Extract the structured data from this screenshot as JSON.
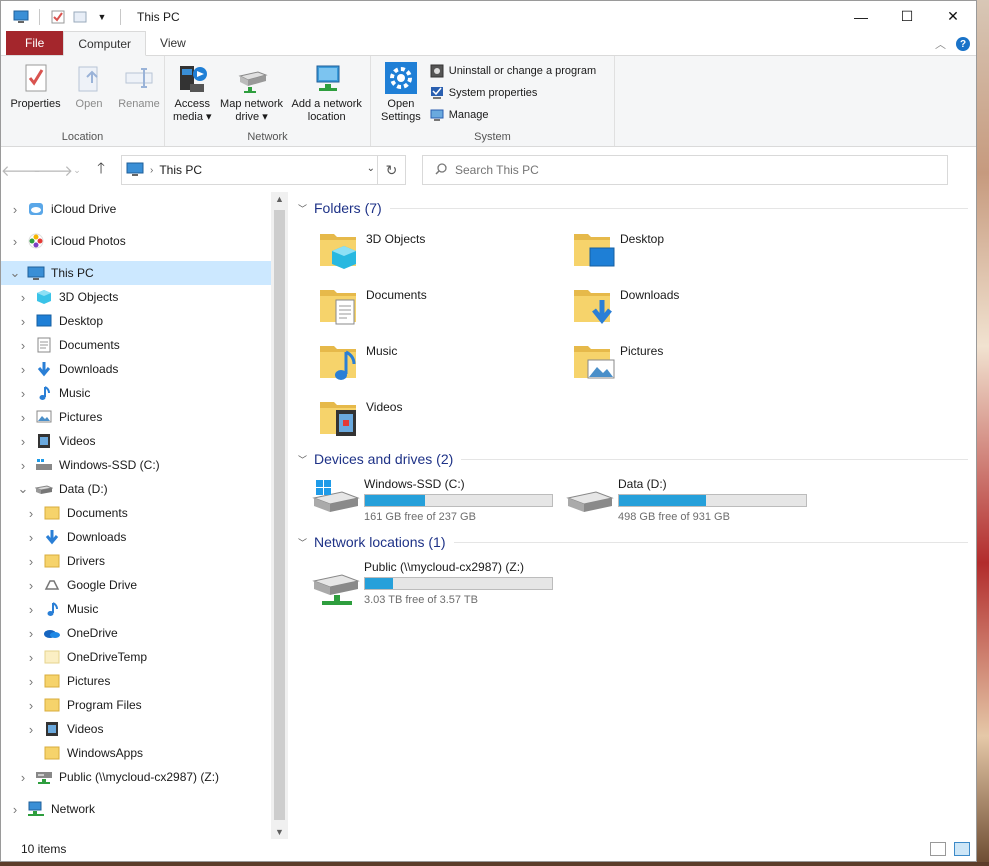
{
  "window": {
    "title": "This PC",
    "controls": {
      "minimize": "—",
      "maximize": "☐",
      "close": "✕"
    }
  },
  "ribbon": {
    "tabs": [
      {
        "label": "File"
      },
      {
        "label": "Computer"
      },
      {
        "label": "View"
      }
    ],
    "groups": {
      "location": {
        "label": "Location",
        "buttons": [
          {
            "label": "Properties",
            "icon": "properties-icon"
          },
          {
            "label": "Open",
            "icon": "open-icon"
          },
          {
            "label": "Rename",
            "icon": "rename-icon"
          }
        ]
      },
      "network": {
        "label": "Network",
        "buttons": [
          {
            "label": "Access\nmedia ▾",
            "line1": "Access",
            "line2": "media ▾",
            "icon": "media-icon"
          },
          {
            "label": "Map network drive ▾",
            "line1": "Map network",
            "line2": "drive ▾",
            "icon": "network-drive-icon"
          },
          {
            "label": "Add a network location",
            "line1": "Add a network",
            "line2": "location",
            "icon": "network-location-icon"
          }
        ]
      },
      "system": {
        "label": "System",
        "open_settings": {
          "line1": "Open",
          "line2": "Settings",
          "icon": "settings-gear-icon"
        },
        "small": [
          {
            "label": "Uninstall or change a program",
            "icon": "uninstall-icon"
          },
          {
            "label": "System properties",
            "icon": "system-properties-icon"
          },
          {
            "label": "Manage",
            "icon": "manage-icon"
          }
        ]
      }
    }
  },
  "address": {
    "path": "This PC",
    "search_placeholder": "Search This PC"
  },
  "nav": {
    "items": [
      {
        "label": "iCloud Drive",
        "level": 0,
        "expand": ">",
        "icon": "icloud-drive-icon"
      },
      {
        "label": "iCloud Photos",
        "level": 0,
        "expand": ">",
        "icon": "icloud-photos-icon"
      },
      {
        "label": "This PC",
        "level": 0,
        "expand": "v",
        "icon": "this-pc-icon",
        "selected": true
      },
      {
        "label": "3D Objects",
        "level": 1,
        "expand": ">",
        "icon": "3d-objects-icon"
      },
      {
        "label": "Desktop",
        "level": 1,
        "expand": ">",
        "icon": "desktop-icon"
      },
      {
        "label": "Documents",
        "level": 1,
        "expand": ">",
        "icon": "documents-icon"
      },
      {
        "label": "Downloads",
        "level": 1,
        "expand": ">",
        "icon": "downloads-icon"
      },
      {
        "label": "Music",
        "level": 1,
        "expand": ">",
        "icon": "music-icon"
      },
      {
        "label": "Pictures",
        "level": 1,
        "expand": ">",
        "icon": "pictures-icon"
      },
      {
        "label": "Videos",
        "level": 1,
        "expand": ">",
        "icon": "videos-icon"
      },
      {
        "label": "Windows-SSD (C:)",
        "level": 1,
        "expand": ">",
        "icon": "windows-drive-icon"
      },
      {
        "label": "Data (D:)",
        "level": 1,
        "expand": "v",
        "icon": "drive-icon"
      },
      {
        "label": "Documents",
        "level": 2,
        "expand": ">",
        "icon": "folder-icon"
      },
      {
        "label": "Downloads",
        "level": 2,
        "expand": ">",
        "icon": "downloads-icon"
      },
      {
        "label": "Drivers",
        "level": 2,
        "expand": ">",
        "icon": "folder-icon"
      },
      {
        "label": "Google Drive",
        "level": 2,
        "expand": ">",
        "icon": "google-drive-icon"
      },
      {
        "label": "Music",
        "level": 2,
        "expand": ">",
        "icon": "music-icon"
      },
      {
        "label": "OneDrive",
        "level": 2,
        "expand": ">",
        "icon": "onedrive-icon"
      },
      {
        "label": "OneDriveTemp",
        "level": 2,
        "expand": ">",
        "icon": "folder-pale-icon"
      },
      {
        "label": "Pictures",
        "level": 2,
        "expand": ">",
        "icon": "folder-icon"
      },
      {
        "label": "Program Files",
        "level": 2,
        "expand": ">",
        "icon": "folder-icon"
      },
      {
        "label": "Videos",
        "level": 2,
        "expand": ">",
        "icon": "videos-icon"
      },
      {
        "label": "WindowsApps",
        "level": 2,
        "expand": "",
        "icon": "folder-icon"
      },
      {
        "label": "Public (\\\\mycloud-cx2987) (Z:)",
        "level": 1,
        "expand": ">",
        "icon": "network-drive-icon"
      },
      {
        "label": "Network",
        "level": 0,
        "expand": ">",
        "icon": "network-icon"
      }
    ]
  },
  "content": {
    "folders_header": "Folders (7)",
    "folders": [
      {
        "label": "3D Objects",
        "icon": "3d-objects-folder-icon"
      },
      {
        "label": "Desktop",
        "icon": "desktop-folder-icon"
      },
      {
        "label": "Documents",
        "icon": "documents-folder-icon"
      },
      {
        "label": "Downloads",
        "icon": "downloads-folder-icon"
      },
      {
        "label": "Music",
        "icon": "music-folder-icon"
      },
      {
        "label": "Pictures",
        "icon": "pictures-folder-icon"
      },
      {
        "label": "Videos",
        "icon": "videos-folder-icon"
      }
    ],
    "devices_header": "Devices and drives (2)",
    "drives": [
      {
        "label": "Windows-SSD (C:)",
        "free": "161 GB free of 237 GB",
        "used_fraction": 0.32,
        "icon": "windows-drive-icon"
      },
      {
        "label": "Data (D:)",
        "free": "498 GB free of 931 GB",
        "used_fraction": 0.465,
        "icon": "drive-icon"
      }
    ],
    "network_header": "Network locations (1)",
    "network": [
      {
        "label": "Public (\\\\mycloud-cx2987) (Z:)",
        "free": "3.03 TB free of 3.57 TB",
        "used_fraction": 0.15,
        "icon": "network-drive-icon"
      }
    ]
  },
  "status": {
    "items": "10 items"
  },
  "colors": {
    "file_tab": "#a4262c",
    "selection": "#cce8ff",
    "header_text": "#1e3287",
    "drive_bar": "#26a0da",
    "folder": "#f6d36b"
  }
}
